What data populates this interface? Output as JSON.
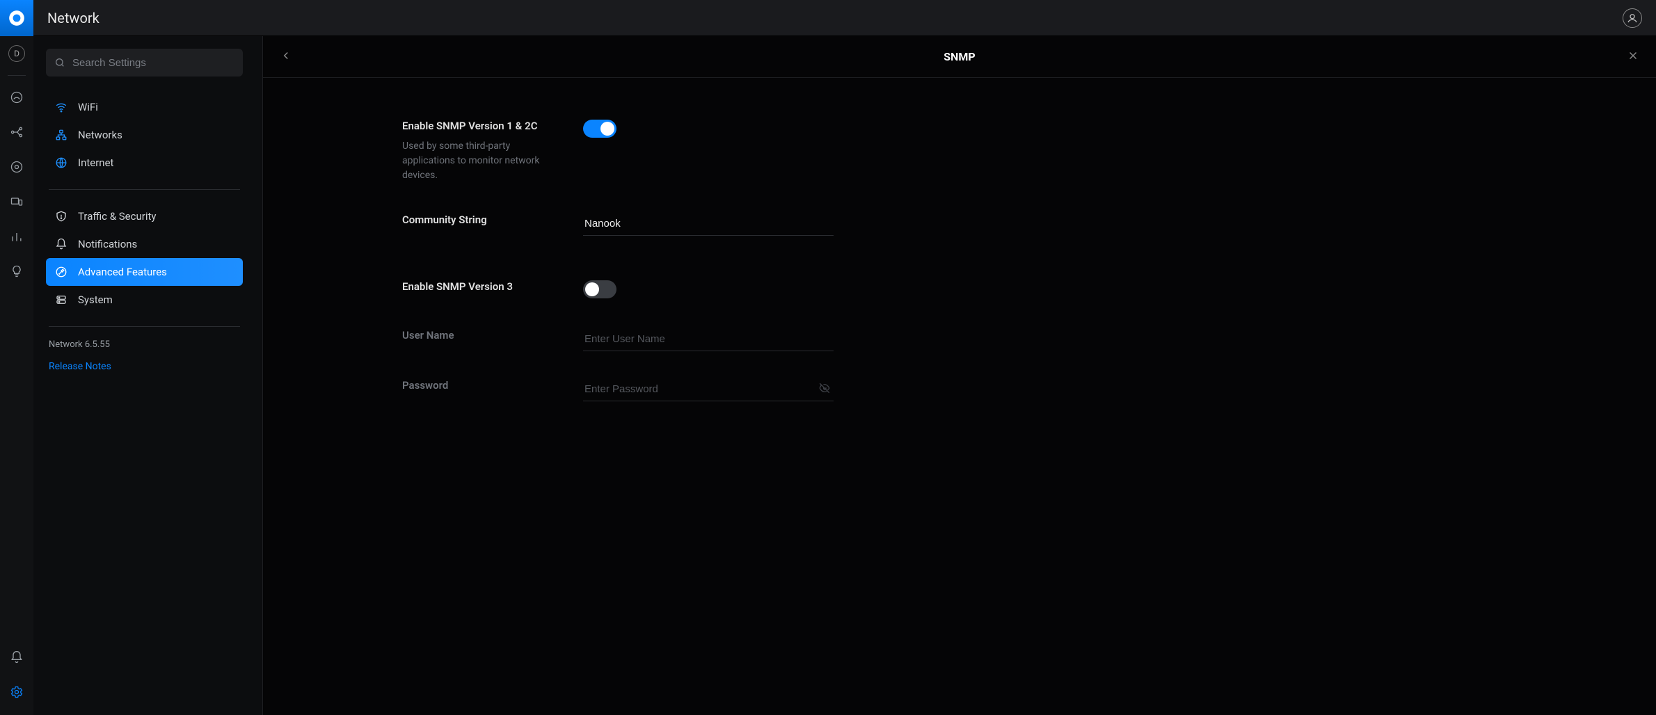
{
  "app": {
    "title": "Network"
  },
  "search": {
    "placeholder": "Search Settings"
  },
  "sidebar": {
    "items": [
      {
        "label": "WiFi"
      },
      {
        "label": "Networks"
      },
      {
        "label": "Internet"
      },
      {
        "label": "Traffic & Security"
      },
      {
        "label": "Notifications"
      },
      {
        "label": "Advanced Features"
      },
      {
        "label": "System"
      }
    ],
    "version": "Network 6.5.55",
    "release_notes": "Release Notes"
  },
  "detail": {
    "title": "SNMP",
    "snmp12": {
      "label": "Enable SNMP Version 1 & 2C",
      "desc": "Used by some third-party applications to monitor network devices.",
      "value": true
    },
    "community": {
      "label": "Community String",
      "value": "Nanook"
    },
    "snmp3": {
      "label": "Enable SNMP Version 3",
      "value": false
    },
    "username": {
      "label": "User Name",
      "placeholder": "Enter User Name",
      "value": ""
    },
    "password": {
      "label": "Password",
      "placeholder": "Enter Password",
      "value": ""
    }
  },
  "rail": {
    "site_letter": "D"
  }
}
